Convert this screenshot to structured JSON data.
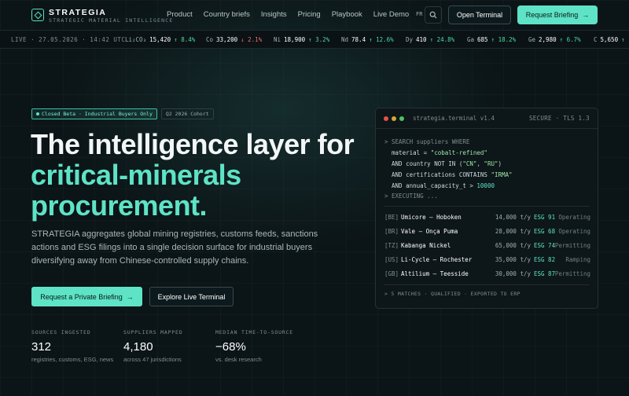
{
  "brand": {
    "name": "STRATEGIA",
    "tagline": "STRATEGIC MATERIAL INTELLIGENCE"
  },
  "nav": {
    "links": [
      "Product",
      "Country briefs",
      "Insights",
      "Pricing",
      "Playbook",
      "Live Demo"
    ],
    "lang": "FR",
    "open_terminal": "Open Terminal",
    "request_briefing": "Request Briefing"
  },
  "ticker": {
    "live": "LIVE · 27.05.2026 · 14:42 UTC",
    "items": [
      {
        "sym": "Li₂CO₃",
        "val": "15,420",
        "chg": "↑ 8.4%",
        "dir": "up"
      },
      {
        "sym": "Co",
        "val": "33,200",
        "chg": "↓ 2.1%",
        "dir": "down"
      },
      {
        "sym": "Ni",
        "val": "18,900",
        "chg": "↑ 3.2%",
        "dir": "up"
      },
      {
        "sym": "Nd",
        "val": "78.4",
        "chg": "↑ 12.6%",
        "dir": "up"
      },
      {
        "sym": "Dy",
        "val": "410",
        "chg": "↑ 24.8%",
        "dir": "up"
      },
      {
        "sym": "Ga",
        "val": "685",
        "chg": "↑ 18.2%",
        "dir": "up"
      },
      {
        "sym": "Ge",
        "val": "2,980",
        "chg": "↑ 6.7%",
        "dir": "up"
      },
      {
        "sym": "C",
        "val": "5,650",
        "chg": "↑",
        "dir": "up"
      }
    ]
  },
  "hero": {
    "badge_beta": "Closed Beta · Industrial Buyers Only",
    "badge_cohort": "Q2 2026 Cohort",
    "headline_1": "The intelligence layer for",
    "headline_2": "critical-minerals",
    "headline_3": "procurement.",
    "subtext": "STRATEGIA aggregates global mining registries, customs feeds, sanctions actions and ESG filings into a single decision surface for industrial buyers diversifying away from Chinese-controlled supply chains.",
    "cta_primary": "Request a Private Briefing",
    "cta_secondary": "Explore Live Terminal"
  },
  "stats": [
    {
      "label": "SOURCES INGESTED",
      "value": "312",
      "note": "registries, customs, ESG, news"
    },
    {
      "label": "SUPPLIERS MAPPED",
      "value": "4,180",
      "note": "across 47 jurisdictions"
    },
    {
      "label": "MEDIAN TIME-TO-SOURCE",
      "value": "−68%",
      "note": "vs. desk research"
    }
  ],
  "terminal": {
    "title": "strategia.terminal v1.4",
    "secure": "SECURE · TLS 1.3",
    "q1": "> SEARCH suppliers WHERE",
    "q2a": "  material = ",
    "q2b": "\"cobalt-refined\"",
    "q3a": "  AND country NOT IN (",
    "q3b": "\"CN\", \"RU\"",
    "q3c": ")",
    "q4a": "  AND certifications CONTAINS ",
    "q4b": "\"IRMA\"",
    "q5a": "  AND annual_capacity_t > ",
    "q5b": "10000",
    "q6": "> EXECUTING ...",
    "rows": [
      {
        "cc": "[BE]",
        "name": "Umicore — Hoboken",
        "cap": "14,000 t/y",
        "esg": "ESG 91",
        "status": "Operating"
      },
      {
        "cc": "[BR]",
        "name": "Vale — Onça Puma",
        "cap": "28,000 t/y",
        "esg": "ESG 68",
        "status": "Operating"
      },
      {
        "cc": "[TZ]",
        "name": "Kabanga Nickel",
        "cap": "65,000 t/y",
        "esg": "ESG 74",
        "status": "Permitting"
      },
      {
        "cc": "[US]",
        "name": "Li-Cycle — Rochester",
        "cap": "35,000 t/y",
        "esg": "ESG 82",
        "status": "Ramping"
      },
      {
        "cc": "[GB]",
        "name": "Altilium — Teesside",
        "cap": "30,000 t/y",
        "esg": "ESG 87",
        "status": "Permitting"
      }
    ],
    "footer": "> 5 MATCHES · QUALIFIED · EXPORTED TO ERP"
  },
  "colors": {
    "accent": "#5ee3c6",
    "background": "#0b1417",
    "up": "#4fd9a5",
    "down": "#f06a6a"
  }
}
